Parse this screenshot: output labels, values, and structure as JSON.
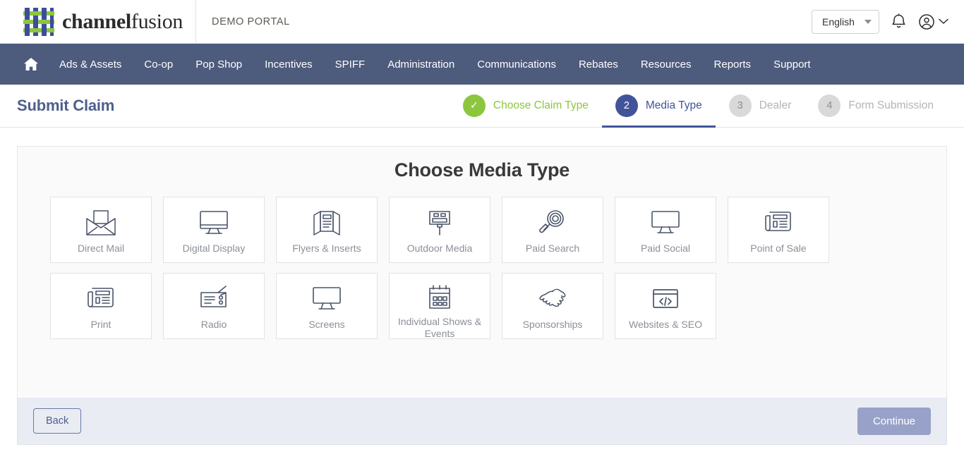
{
  "header": {
    "logo_word_bold": "channel",
    "logo_word_thin": "fusion",
    "portal_title": "DEMO PORTAL",
    "language": "English",
    "notifications_icon": "bell-icon",
    "account_icon": "user-circle-icon"
  },
  "nav": {
    "home_icon": "home-icon",
    "items": [
      {
        "label": "Ads & Assets"
      },
      {
        "label": "Co-op"
      },
      {
        "label": "Pop Shop"
      },
      {
        "label": "Incentives"
      },
      {
        "label": "SPIFF"
      },
      {
        "label": "Administration"
      },
      {
        "label": "Communications"
      },
      {
        "label": "Rebates"
      },
      {
        "label": "Resources"
      },
      {
        "label": "Reports"
      },
      {
        "label": "Support"
      }
    ]
  },
  "page": {
    "title": "Submit Claim",
    "heading": "Choose Media Type"
  },
  "steps": [
    {
      "number": "✓",
      "label": "Choose Claim Type",
      "state": "done"
    },
    {
      "number": "2",
      "label": "Media Type",
      "state": "active"
    },
    {
      "number": "3",
      "label": "Dealer",
      "state": "todo"
    },
    {
      "number": "4",
      "label": "Form Submission",
      "state": "todo"
    }
  ],
  "media_types": [
    {
      "label": "Direct Mail",
      "icon": "envelope-icon"
    },
    {
      "label": "Digital Display",
      "icon": "monitor-icon"
    },
    {
      "label": "Flyers & Inserts",
      "icon": "brochure-icon"
    },
    {
      "label": "Outdoor Media",
      "icon": "billboard-icon"
    },
    {
      "label": "Paid Search",
      "icon": "magnifier-icon"
    },
    {
      "label": "Paid Social",
      "icon": "monitor-plain-icon"
    },
    {
      "label": "Point of Sale",
      "icon": "newspaper-icon"
    },
    {
      "label": "Print",
      "icon": "newspaper-icon"
    },
    {
      "label": "Radio",
      "icon": "radio-icon"
    },
    {
      "label": "Screens",
      "icon": "monitor-plain-icon"
    },
    {
      "label": "Individual Shows & Events",
      "icon": "calendar-icon"
    },
    {
      "label": "Sponsorships",
      "icon": "handshake-icon"
    },
    {
      "label": "Websites & SEO",
      "icon": "browser-code-icon"
    }
  ],
  "footer": {
    "back_label": "Back",
    "continue_label": "Continue"
  },
  "colors": {
    "nav_bg": "#4d5b7c",
    "brand_blue": "#41549a",
    "step_done_green": "#8cc63e",
    "continue_disabled": "#98a2c9",
    "icon_stroke": "#4a5468"
  }
}
